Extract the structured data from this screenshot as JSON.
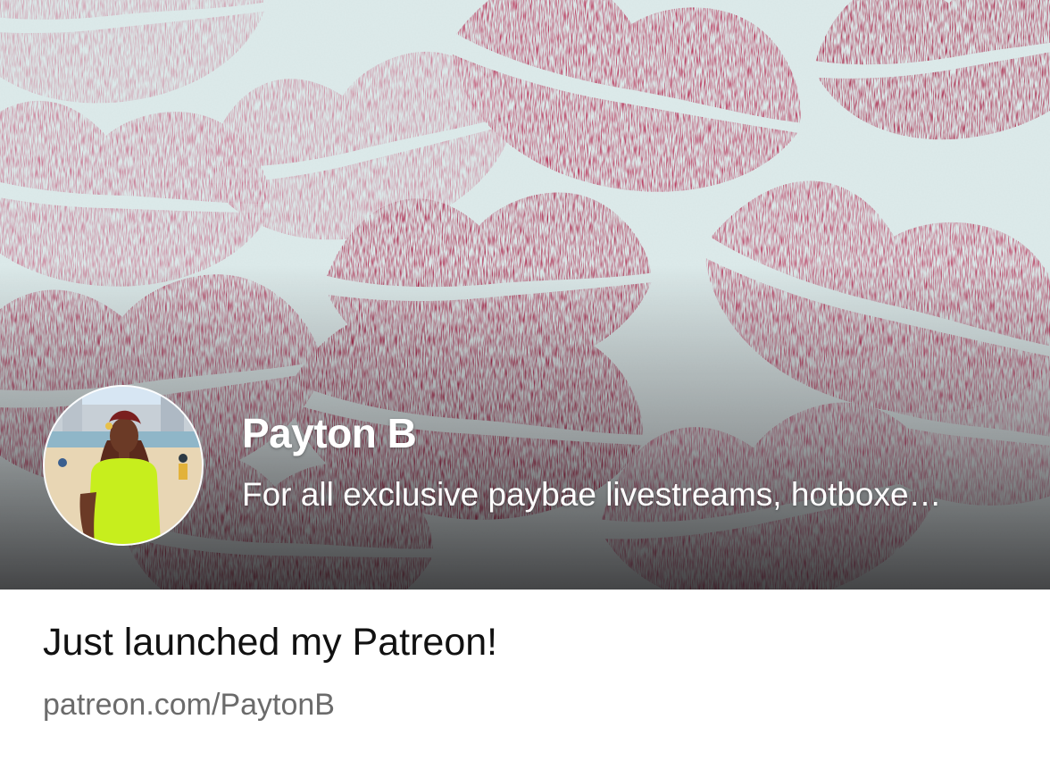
{
  "hero": {
    "background": "lipstick-kisses-banner",
    "accent_color": "#a3163c",
    "creator": {
      "name": "Payton B",
      "summary": "For all exclusive paybae livestreams, hotboxe…",
      "avatar": "creator-avatar"
    }
  },
  "footer": {
    "headline": "Just launched my Patreon!",
    "url": "patreon.com/PaytonB"
  }
}
